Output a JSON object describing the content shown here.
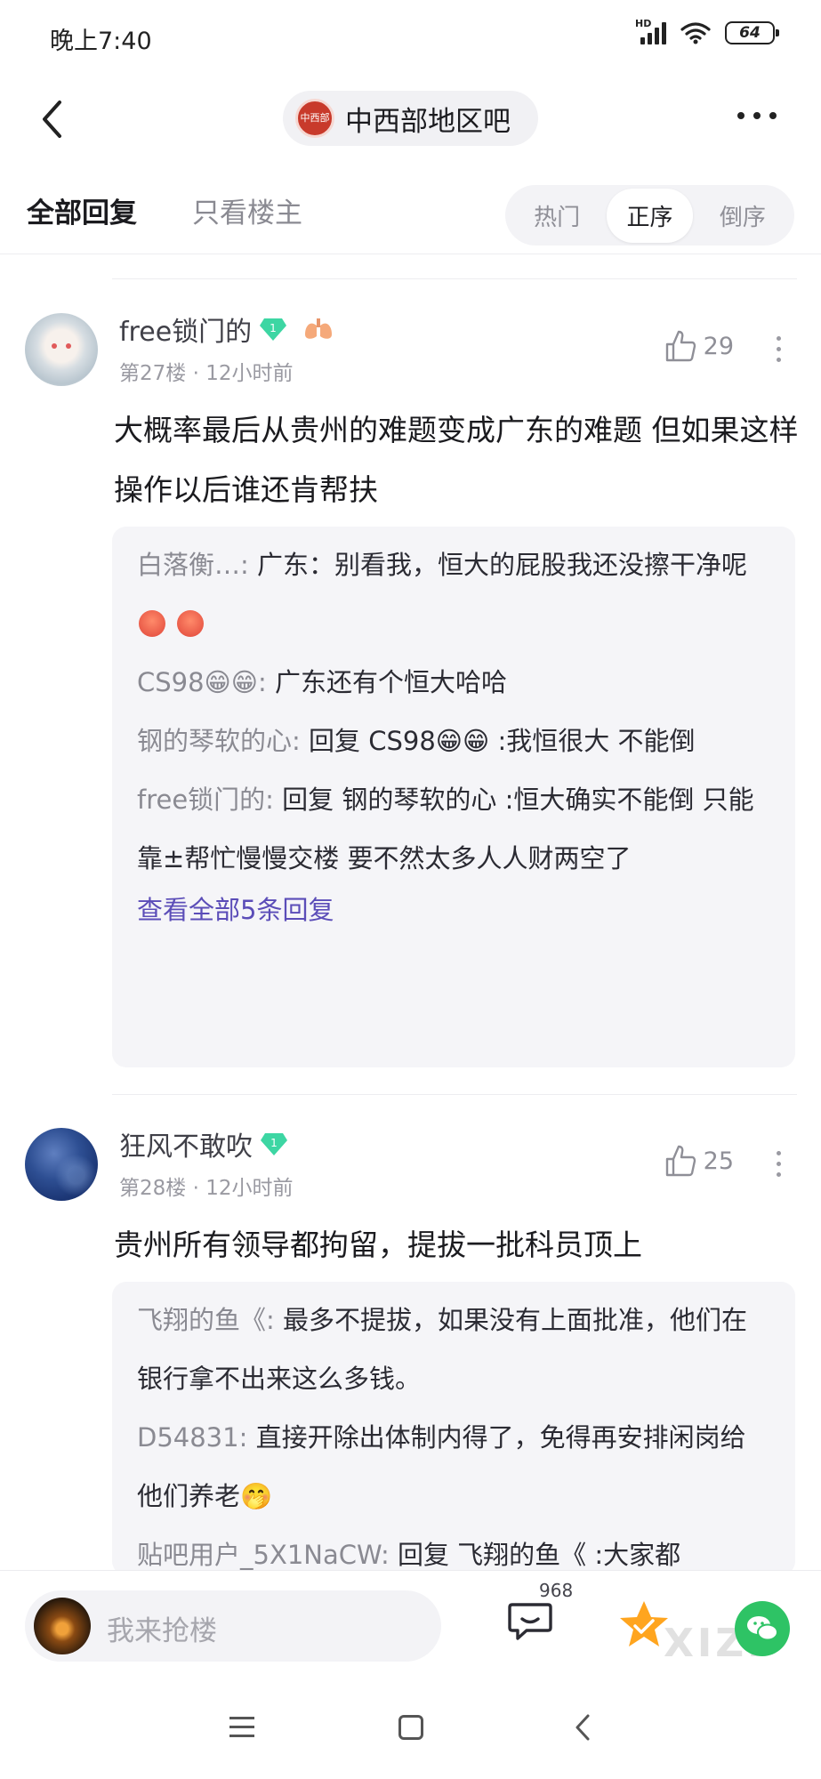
{
  "status_bar": {
    "time": "晚上7:40",
    "network": "HD",
    "battery": "64"
  },
  "header": {
    "forum_name": "中西部地区吧",
    "forum_logo_text": "中西部"
  },
  "tabs": {
    "all_replies": "全部回复",
    "only_op": "只看楼主"
  },
  "sort": {
    "options": [
      "热门",
      "正序",
      "倒序"
    ],
    "selected": "正序"
  },
  "posts": [
    {
      "username": "free锁门的",
      "level": "1",
      "floor_time": "第27楼 · 12小时前",
      "likes": "29",
      "content": "大概率最后从贵州的难题变成广东的难题 但如果这样操作以后谁还肯帮扶",
      "replies": [
        {
          "who": "白落衡…:",
          "text": " 广东：别看我，恒大的屁股我还没擦干净呢",
          "emoji": [
            "angry-face-icon",
            "angry-face-icon"
          ]
        },
        {
          "who": "CS98😁😁:",
          "text": " 广东还有个恒大哈哈"
        },
        {
          "who": "钢的琴软的心:",
          "text": " 回复 CS98😁😁 :我恒很大 不能倒"
        },
        {
          "who": "free锁门的:",
          "text": " 回复 钢的琴软的心 :恒大确实不能倒 只能靠±帮忙慢慢交楼 要不然太多人人财两空了"
        }
      ],
      "view_all": "查看全部5条回复"
    },
    {
      "username": "狂风不敢吹",
      "level": "1",
      "floor_time": "第28楼 · 12小时前",
      "likes": "25",
      "content": "贵州所有领导都拘留，提拔一批科员顶上",
      "replies": [
        {
          "who": "飞翔的鱼《:",
          "text": " 最多不提拔，如果没有上面批准，他们在银行拿不出来这么多钱。"
        },
        {
          "who": "D54831:",
          "text": " 直接开除出体制内得了，免得再安排闲岗给他们养老🤭"
        },
        {
          "who": "贴吧用户_5X1NaCW:",
          "text": " 回复 飞翔的鱼《 :大家都"
        }
      ]
    }
  ],
  "bottom_bar": {
    "placeholder": "我来抢楼",
    "reply_count": "968",
    "watermark": "XIZI"
  },
  "colors": {
    "link": "#5b4db8",
    "badge": "#3dd6a3",
    "star": "#ffa51f",
    "wechat": "#2ec365"
  }
}
